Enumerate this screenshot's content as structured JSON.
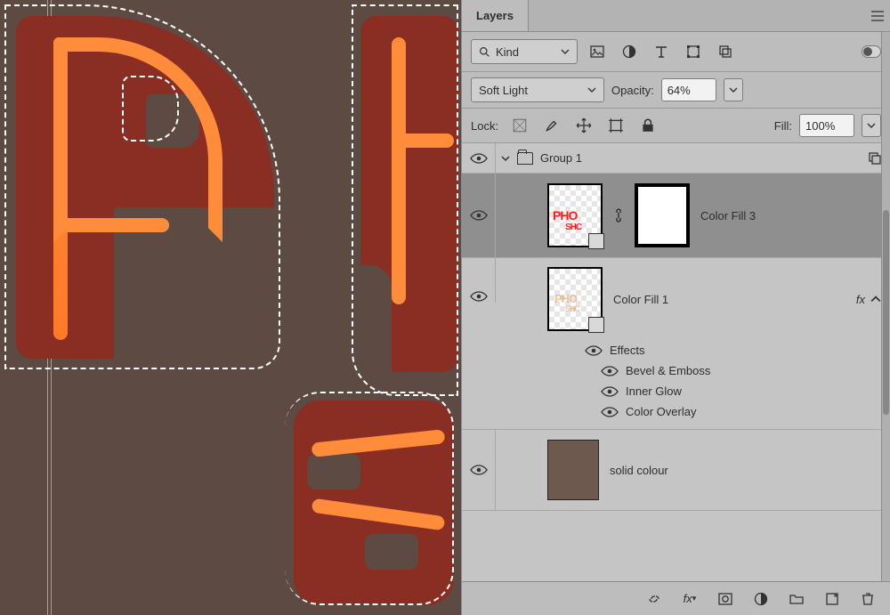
{
  "panel": {
    "title": "Layers",
    "filter": {
      "kind_label": "Kind",
      "icons": [
        "image-icon",
        "adjustment-icon",
        "type-icon",
        "shape-icon",
        "smartobject-icon"
      ]
    },
    "blend": {
      "mode": "Soft Light",
      "opacity_label": "Opacity:",
      "opacity_value": "64%"
    },
    "lock": {
      "label": "Lock:",
      "fill_label": "Fill:",
      "fill_value": "100%",
      "icons": [
        "transparent-lock-icon",
        "brush-lock-icon",
        "move-lock-icon",
        "artboard-lock-icon",
        "full-lock-icon"
      ]
    },
    "group": {
      "name": "Group 1"
    },
    "layers": [
      {
        "name": "Color Fill 3"
      },
      {
        "name": "Color Fill 1",
        "fx_badge": "fx",
        "effects_title": "Effects",
        "effects": [
          "Bevel & Emboss",
          "Inner Glow",
          "Color Overlay"
        ]
      },
      {
        "name": "solid colour"
      }
    ],
    "bottom_icons": [
      "link-icon",
      "fx-icon",
      "mask-icon",
      "adjustment-icon",
      "group-icon",
      "new-layer-icon",
      "trash-icon"
    ]
  },
  "colors": {
    "canvas_bg": "#5d4b43",
    "panel_bg": "#bdbdbd",
    "selected_layer": "#8f8f8f",
    "letter_fill": "#8a2d22",
    "letter_stroke": "#ff8c3a",
    "guide": "#00e6d8"
  }
}
